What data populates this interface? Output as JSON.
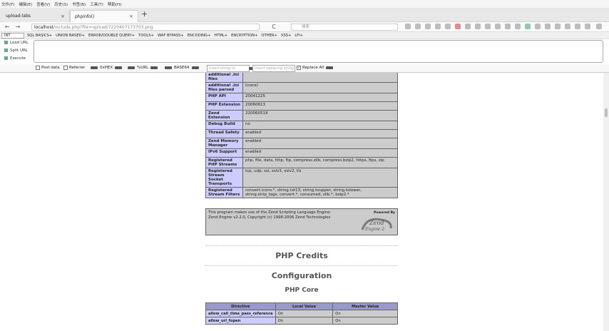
{
  "menubar": [
    "文件(F)",
    "编辑(E)",
    "查看(V)",
    "历史(S)",
    "书签(B)",
    "工具(T)",
    "帮助(H)"
  ],
  "tabs": [
    {
      "label": "upload-labs",
      "close": "×"
    },
    {
      "label": "phpinfo()",
      "close": "×"
    }
  ],
  "new_tab": "+",
  "nav": {
    "back": "←",
    "forward": "→",
    "reload": "C",
    "url_host": "localhost",
    "url_rest": "/include.php?file=upload/7220407173703.png",
    "search_placeholder": "搜索"
  },
  "hackbar": {
    "select": "INT",
    "menus": [
      "SQL BASICS+",
      "UNION BASED+",
      "ERROR/DOUBLE QUERY+",
      "TOOLS+",
      "WAF BYPASS+",
      "ENCODING+",
      "HTML+",
      "ENCRYPTION+",
      "OTHER+",
      "XSS+",
      "LFI+"
    ],
    "load_url": "Load URL",
    "split_url": "Split URL",
    "execute": "Execute",
    "post_data": "Post data",
    "referrer": "Referrer",
    "hex": "0xHEX",
    "url": "%URL",
    "base64": "BASE64",
    "insert_placeholder": "Insert string to replace",
    "replace_placeholder": "Insert replacing string",
    "replace_all": "Replace All",
    "post_checked": false,
    "referrer_checked": false,
    "replace_all_checked": true
  },
  "info_rows": [
    {
      "k": "additional .ini files",
      "v": ""
    },
    {
      "k": "additional .ini files parsed",
      "v": "(none)"
    },
    {
      "k": "PHP API",
      "v": "20041225"
    },
    {
      "k": "PHP Extension",
      "v": "20060613"
    },
    {
      "k": "Zend Extension",
      "v": "220060519"
    },
    {
      "k": "Debug Build",
      "v": "no"
    },
    {
      "k": "Thread Safety",
      "v": "enabled"
    },
    {
      "k": "Zend Memory Manager",
      "v": "enabled"
    },
    {
      "k": "IPv6 Support",
      "v": "enabled"
    },
    {
      "k": "Registered PHP Streams",
      "v": "php, file, data, http, ftp, compress.zlib, compress.bzip2, https, ftps, zip"
    },
    {
      "k": "Registered Stream Socket Transports",
      "v": "tcp, udp, ssl, sslv3, sslv2, tls"
    },
    {
      "k": "Registered Stream Filters",
      "v": "convert.iconv.*, string.rot13, string.toupper, string.tolower, string.strip_tags, convert.*, consumed, zlib.*, bzip2.*"
    }
  ],
  "zend": {
    "line1": "This program makes use of the Zend Scripting Language Engine:",
    "line2": "Zend Engine v2.2.0, Copyright (c) 1998-2006 Zend Technologies",
    "powered": "Powered By",
    "logo1": "Zend",
    "logo2": "Engine 2"
  },
  "headings": {
    "credits": "PHP Credits",
    "configuration": "Configuration",
    "core": "PHP Core"
  },
  "core_table": {
    "headers": [
      "Directive",
      "Local Value",
      "Master Value"
    ],
    "rows": [
      [
        "allow_call_time_pass_reference",
        "On",
        "On"
      ],
      [
        "allow_url_fopen",
        "On",
        "On"
      ]
    ]
  }
}
